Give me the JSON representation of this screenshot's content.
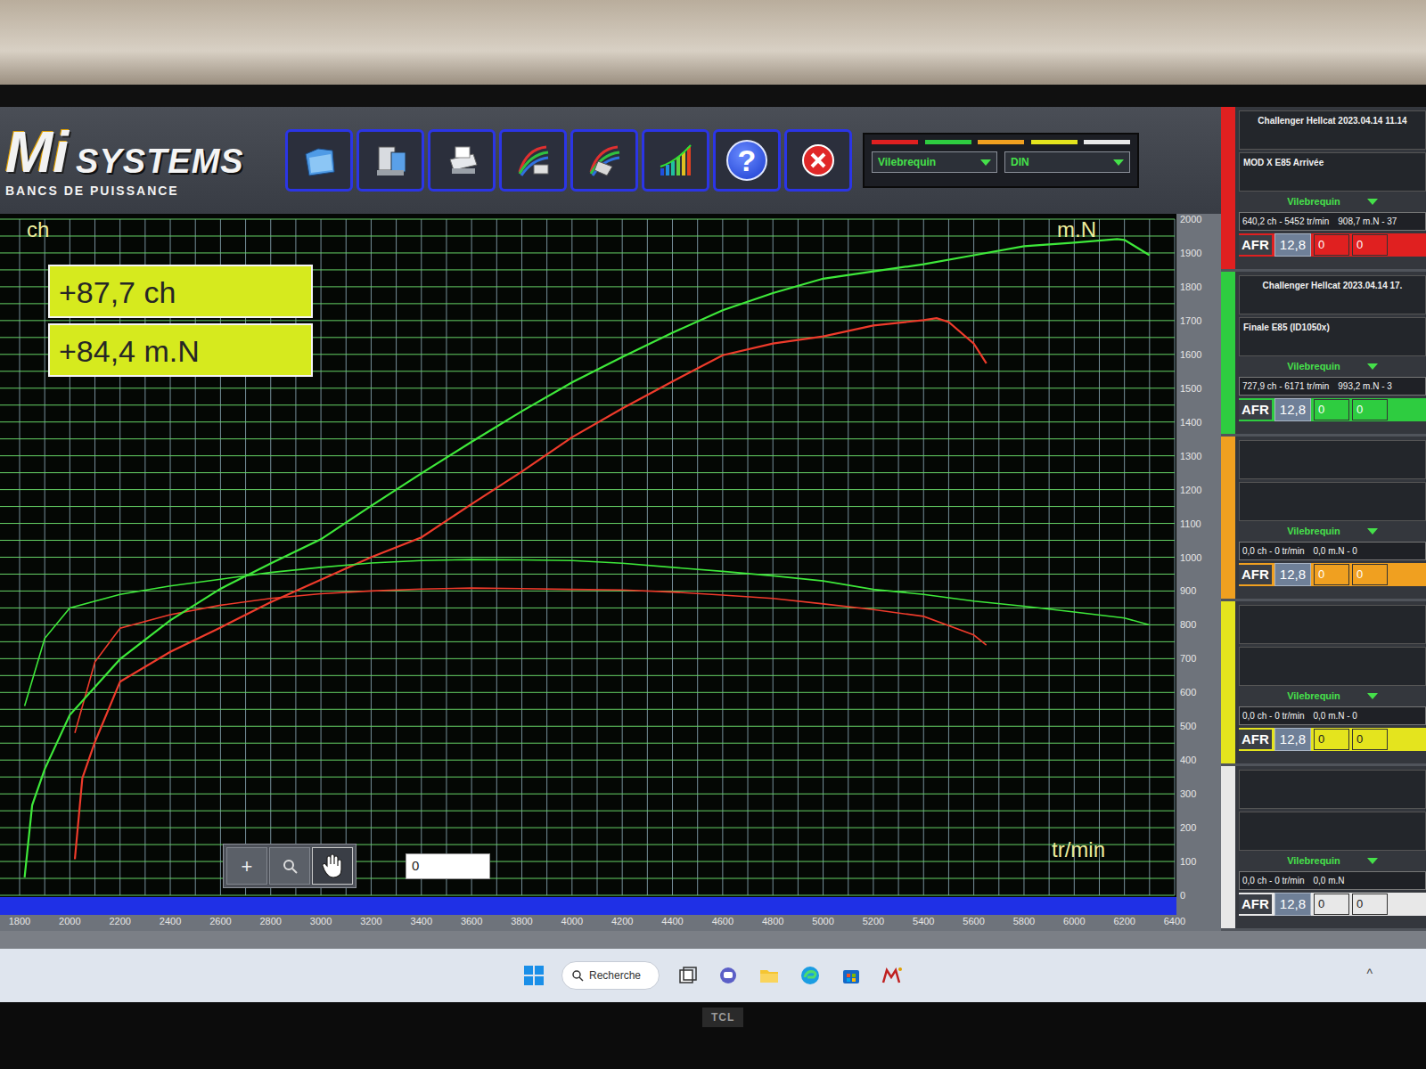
{
  "logo": {
    "brand_a": "Mi",
    "brand_b": "SYSTEMS",
    "tagline": "BANCS DE PUISSANCE"
  },
  "toolbar": [
    {
      "kind": "open"
    },
    {
      "kind": "save"
    },
    {
      "kind": "print"
    },
    {
      "kind": "curves"
    },
    {
      "kind": "curves-edit"
    },
    {
      "kind": "bars"
    },
    {
      "kind": "help",
      "label": "?"
    },
    {
      "kind": "close"
    }
  ],
  "legend": {
    "runs": [
      {
        "color": "#e02020"
      },
      {
        "color": "#2ecc40"
      },
      {
        "color": "#f0a020"
      },
      {
        "color": "#e4e41e"
      },
      {
        "color": "#e8e8e8"
      }
    ],
    "selects": [
      "Vilebrequin",
      "DIN"
    ]
  },
  "chart": {
    "power_label": "ch",
    "torque_label": "m.N",
    "x_label": "tr/min",
    "deltas": [
      "+87,7 ch",
      "+84,4 m.N"
    ],
    "x_ticks": [
      "1800",
      "2000",
      "2200",
      "2400",
      "2600",
      "2800",
      "3000",
      "3200",
      "3400",
      "3600",
      "3800",
      "4000",
      "4200",
      "4400",
      "4600",
      "4800",
      "5000",
      "5200",
      "5400",
      "5600",
      "5800",
      "6000",
      "6200",
      "6400"
    ],
    "y_ticks": [
      "0",
      "100",
      "200",
      "300",
      "400",
      "500",
      "600",
      "700",
      "800",
      "900",
      "1000",
      "1100",
      "1200",
      "1300",
      "1400",
      "1500",
      "1600",
      "1700",
      "1800",
      "1900",
      "2000"
    ],
    "series": [
      {
        "kind": "power",
        "color": "#ee3b2b",
        "rpm": [
          2020,
          2050,
          2100,
          2200,
          2400,
          2600,
          2800,
          3000,
          3200,
          3400,
          3600,
          3800,
          4000,
          4200,
          4400,
          4600,
          4800,
          5000,
          5200,
          5400,
          5452,
          5500,
          5600,
          5650
        ],
        "values": [
          40,
          130,
          170,
          237,
          270,
          297,
          325,
          350,
          375,
          397,
          434,
          470,
          508,
          540,
          570,
          599,
          612,
          620,
          632,
          638,
          640.2,
          636,
          612,
          590
        ]
      },
      {
        "kind": "torque",
        "color": "#ee3b2b",
        "rpm": [
          2020,
          2100,
          2200,
          2400,
          2600,
          2800,
          3000,
          3200,
          3400,
          3600,
          3800,
          4000,
          4200,
          4400,
          4600,
          4800,
          5000,
          5200,
          5400,
          5600,
          5650
        ],
        "values": [
          480,
          690,
          790,
          830,
          858,
          878,
          892,
          900,
          906,
          908.7,
          907,
          905,
          903,
          897,
          888,
          878,
          862,
          845,
          825,
          770,
          740
        ]
      },
      {
        "kind": "power",
        "color": "#3ee83a",
        "rpm": [
          1820,
          1850,
          1900,
          2000,
          2200,
          2400,
          2600,
          2800,
          3000,
          3200,
          3400,
          3600,
          3800,
          4000,
          4200,
          4400,
          4600,
          4800,
          5000,
          5200,
          5400,
          5600,
          5800,
          6000,
          6171,
          6200,
          6300
        ],
        "values": [
          20,
          100,
          140,
          200,
          262,
          305,
          340,
          368,
          395,
          432,
          468,
          503,
          537,
          569,
          597,
          624,
          649,
          668,
          684,
          692,
          700,
          710,
          720,
          724,
          727.9,
          727,
          710
        ]
      },
      {
        "kind": "torque",
        "color": "#3ee83a",
        "rpm": [
          1820,
          1900,
          2000,
          2200,
          2400,
          2600,
          2800,
          3000,
          3200,
          3400,
          3600,
          3800,
          4000,
          4200,
          4400,
          4600,
          4800,
          5000,
          5200,
          5400,
          5600,
          5800,
          6000,
          6200,
          6300
        ],
        "values": [
          560,
          760,
          850,
          890,
          915,
          935,
          955,
          970,
          983,
          990,
          993.2,
          992,
          990,
          982,
          970,
          958,
          945,
          930,
          905,
          890,
          870,
          855,
          838,
          820,
          800
        ]
      }
    ]
  },
  "zoom": {
    "buttons": [
      {
        "kind": "plus",
        "label": "+",
        "selected": false
      },
      {
        "kind": "zoom",
        "selected": false
      },
      {
        "kind": "hand",
        "selected": true
      }
    ],
    "value": "0"
  },
  "runs": [
    {
      "color": "#e02020",
      "title": "Challenger Hellcat  2023.04.14 11.14",
      "note": "MOD X E85 Arrivée",
      "mode": "Vilebrequin",
      "power": "640,2 ch - 5452 tr/min",
      "torque": "908,7 m.N - 37",
      "afr_label": "AFR",
      "afr": "12,8",
      "fields": [
        "0",
        "0"
      ]
    },
    {
      "color": "#2ecc40",
      "title": "Challenger Hellcat  2023.04.14 17.",
      "note": "Finale E85 (ID1050x)",
      "mode": "Vilebrequin",
      "power": "727,9 ch - 6171 tr/min",
      "torque": "993,2 m.N - 3",
      "afr_label": "AFR",
      "afr": "12,8",
      "fields": [
        "0",
        "0"
      ]
    },
    {
      "color": "#f0a020",
      "title": "",
      "note": "",
      "mode": "Vilebrequin",
      "power": "0,0 ch - 0 tr/min",
      "torque": "0,0 m.N - 0",
      "afr_label": "AFR",
      "afr": "12,8",
      "fields": [
        "0",
        "0"
      ]
    },
    {
      "color": "#e4e41e",
      "title": "",
      "note": "",
      "mode": "Vilebrequin",
      "power": "0,0 ch - 0 tr/min",
      "torque": "0,0 m.N - 0",
      "afr_label": "AFR",
      "afr": "12,8",
      "fields": [
        "0",
        "0"
      ]
    },
    {
      "color": "#e8e8e8",
      "title": "",
      "note": "",
      "mode": "Vilebrequin",
      "power": "0,0 ch - 0 tr/min",
      "torque": "0,0 m.N",
      "afr_label": "AFR",
      "afr": "12,8",
      "fields": [
        "0",
        "0"
      ]
    }
  ],
  "taskbar": {
    "search": "Recherche",
    "apps": [
      {
        "kind": "taskview"
      },
      {
        "kind": "chat"
      },
      {
        "kind": "folder"
      },
      {
        "kind": "edge"
      },
      {
        "kind": "store"
      },
      {
        "kind": "mi"
      }
    ],
    "tray": "^"
  },
  "monitor": {
    "brand": "TCL"
  }
}
